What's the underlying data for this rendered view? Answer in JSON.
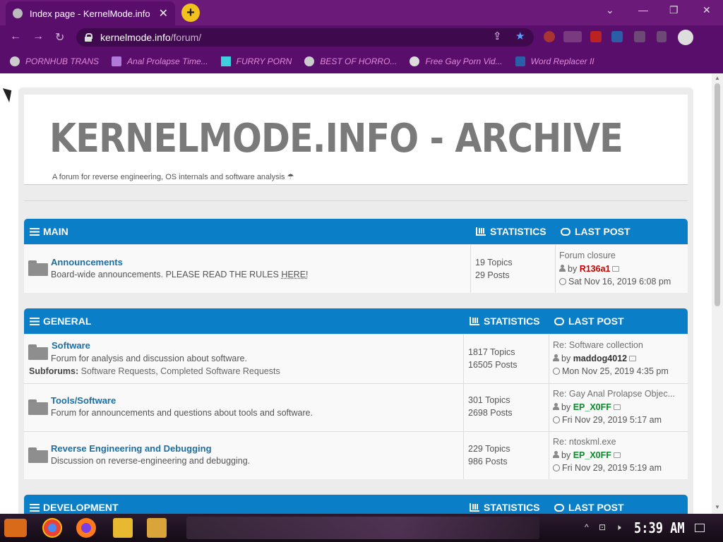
{
  "browser": {
    "tab_title": "Index page - KernelMode.info",
    "tab_close": "✕",
    "new_tab": "+",
    "url_host": "kernelmode.info",
    "url_path": "/forum/",
    "window_controls": {
      "chevron": "⌄",
      "minimize": "—",
      "restore": "❐",
      "close": "✕"
    },
    "nav": {
      "back": "←",
      "forward": "→",
      "reload": "↻"
    },
    "omnibox_icons": {
      "share": "⇪",
      "star": "★"
    },
    "bookmarks": [
      {
        "label": "PORNHUB TRANS",
        "icon": "globe-icon"
      },
      {
        "label": "Anal Prolapse Time...",
        "icon": "sigma-icon"
      },
      {
        "label": "FURRY PORN",
        "icon": "lambda-icon"
      },
      {
        "label": "BEST OF HORRO...",
        "icon": "globe-icon"
      },
      {
        "label": "Free Gay Porn Vid...",
        "icon": "skull-icon"
      },
      {
        "label": "Word Replacer II",
        "icon": "wr-icon"
      }
    ],
    "accent": "#5a0e6b"
  },
  "site": {
    "name": "KERNELMODE.INFO - ARCHIVE",
    "description": "A forum for reverse engineering, OS internals and software analysis ☂"
  },
  "categories": [
    {
      "name": "MAIN",
      "stats_header": "STATISTICS",
      "lastpost_header": "LAST POST",
      "forums": [
        {
          "title": "Announcements",
          "description": "Board-wide announcements. PLEASE READ THE RULES ",
          "description_link": "HERE!",
          "topics": "19 Topics",
          "posts": "29 Posts",
          "last_title": "Forum closure",
          "last_by": "by",
          "last_user": "R136a1",
          "last_time": "Sat Nov 16, 2019 6:08 pm"
        }
      ]
    },
    {
      "name": "GENERAL",
      "stats_header": "STATISTICS",
      "lastpost_header": "LAST POST",
      "forums": [
        {
          "title": "Software",
          "description": "Forum for analysis and discussion about software.",
          "subforums_label": "Subforums:",
          "subforums": "Software Requests, Completed Software Requests",
          "topics": "1817 Topics",
          "posts": "16505 Posts",
          "last_title": "Re: Software collection",
          "last_by": "by",
          "last_user": "maddog4012",
          "last_time": "Mon Nov 25, 2019 4:35 pm"
        },
        {
          "title": "Tools/Software",
          "description": "Forum for announcements and questions about tools and software.",
          "topics": "301 Topics",
          "posts": "2698 Posts",
          "last_title": "Re: Gay Anal Prolapse Objec...",
          "last_by": "by",
          "last_user": "EP_X0FF",
          "last_time": "Fri Nov 29, 2019 5:17 am"
        },
        {
          "title": "Reverse Engineering and Debugging",
          "description": "Discussion on reverse-engineering and debugging.",
          "topics": "229 Topics",
          "posts": "986 Posts",
          "last_title": "Re: ntoskml.exe",
          "last_by": "by",
          "last_user": "EP_X0FF",
          "last_time": "Fri Nov 29, 2019 5:19 am"
        }
      ]
    },
    {
      "name": "DEVELOPMENT",
      "stats_header": "STATISTICS",
      "lastpost_header": "LAST POST"
    }
  ],
  "taskbar": {
    "clock": "5:39 AM",
    "tray_icons": [
      "^",
      "⊡",
      "🕨"
    ]
  }
}
